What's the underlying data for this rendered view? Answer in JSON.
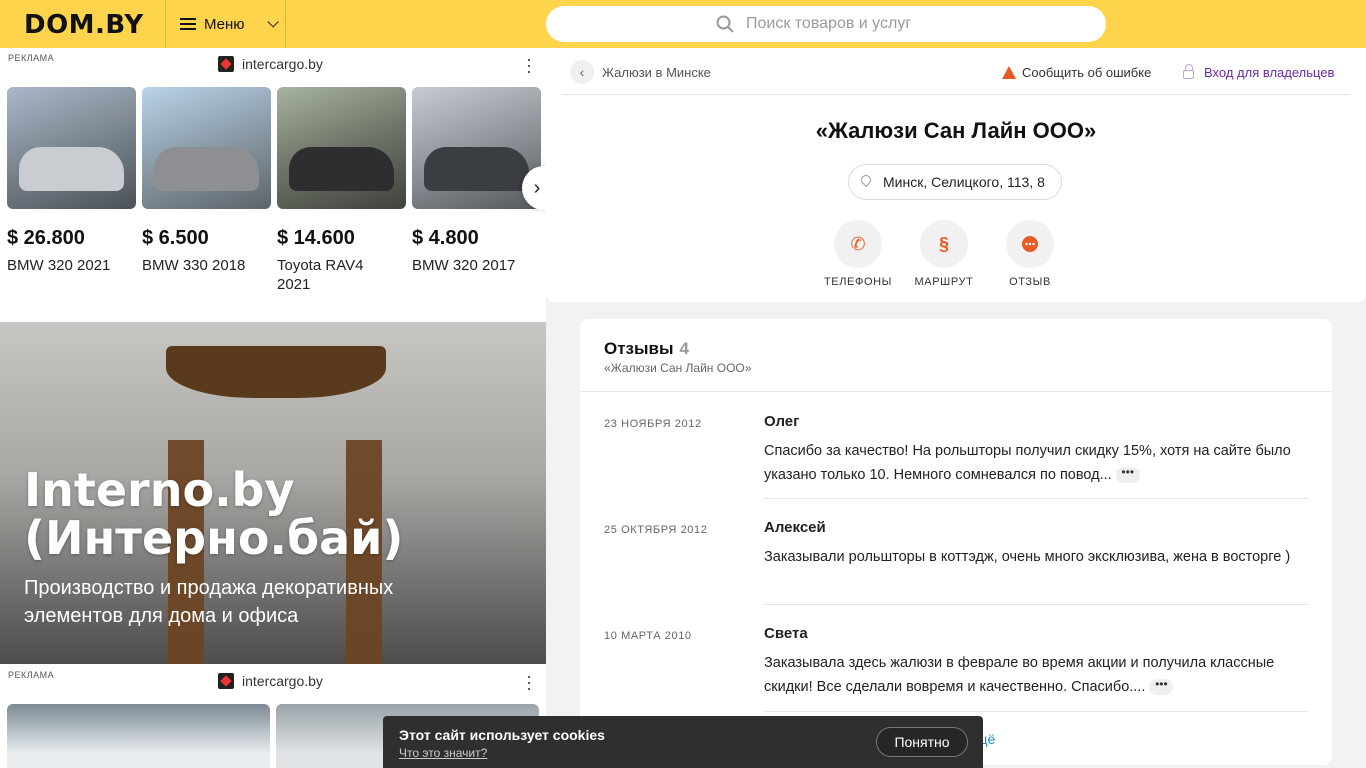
{
  "header": {
    "logo": "DOM.BY",
    "menu_label": "Меню",
    "search_placeholder": "Поиск товаров и услуг"
  },
  "ads": [
    {
      "label": "РЕКЛАМА",
      "source": "intercargo.by",
      "cards": [
        {
          "price": "$ 26.800",
          "model": "BMW 320 2021"
        },
        {
          "price": "$ 6.500",
          "model": "BMW 330 2018"
        },
        {
          "price": "$ 14.600",
          "model": "Toyota RAV4 2021"
        },
        {
          "price": "$ 4.800",
          "model": "BMW 320 2017"
        }
      ]
    },
    {
      "label": "РЕКЛАМА",
      "source": "intercargo.by"
    }
  ],
  "promo": {
    "title_line1": "Interno.by",
    "title_line2": "(Интерно.бай)",
    "subtitle": "Производство и продажа декоративных элементов для дома и офиса"
  },
  "company": {
    "breadcrumb": "Жалюзи в Минске",
    "report_label": "Сообщить об ошибке",
    "owners_label": "Вход для владельцев",
    "name": "«Жалюзи Сан Лайн ООО»",
    "address": "Минск, Селицкого, 113, 8",
    "actions": {
      "phones": "ТЕЛЕФОНЫ",
      "route": "МАРШРУТ",
      "review": "ОТЗЫВ"
    }
  },
  "reviews": {
    "title": "Отзывы",
    "count": "4",
    "subtitle": "«Жалюзи Сан Лайн ООО»",
    "items": [
      {
        "date": "23 НОЯБРЯ 2012",
        "author": "Олег",
        "text": "Спасибо за качество! На рольшторы получил скидку 15%, хотя на сайте было указано только 10. Немного сомневался по повод..."
      },
      {
        "date": "25 ОКТЯБРЯ 2012",
        "author": "Алексей",
        "text": "Заказывали рольшторы в коттэдж, очень много эксклюзива, жена в восторге )"
      },
      {
        "date": "10 МАРТА 2010",
        "author": "Света",
        "text": "Заказывала здесь жалюзи в феврале во время акции и получила классные скидки! Все сделали вовремя и качественно. Спасибо...."
      }
    ],
    "more_fragment": "щё"
  },
  "cookie": {
    "title": "Этот сайт использует cookies",
    "link": "Что это значит?",
    "button": "Понятно"
  }
}
